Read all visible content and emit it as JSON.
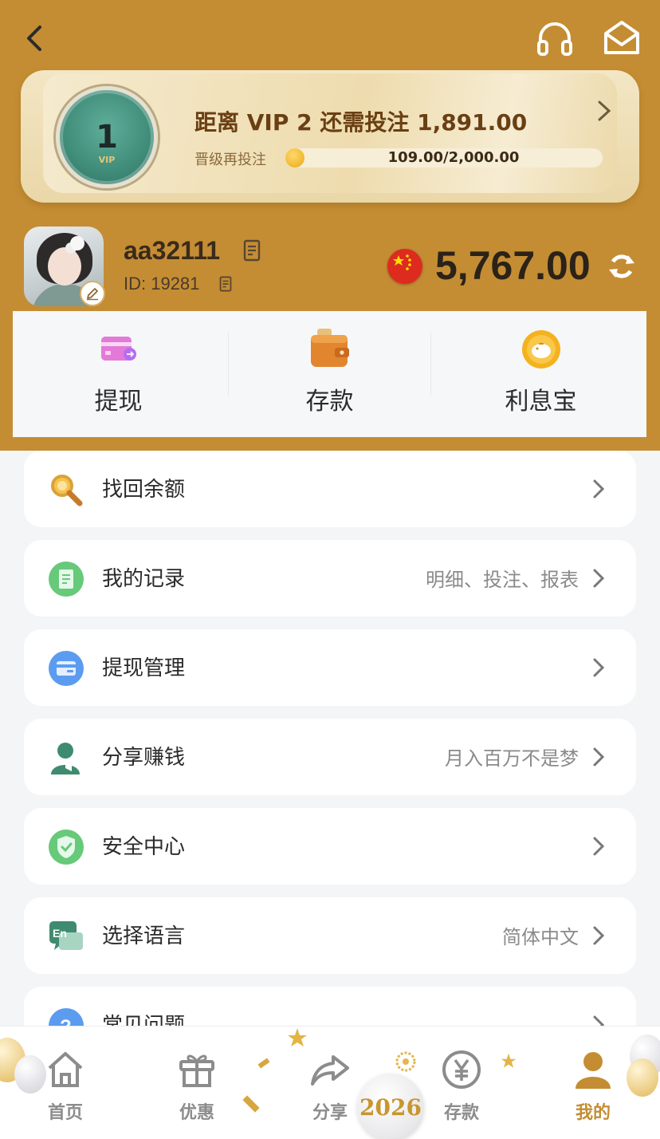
{
  "colors": {
    "brand_gold": "#c48d33",
    "background": "#f4f5f7",
    "active_tab": "#c48d33"
  },
  "header": {
    "icons": [
      "back-icon",
      "headset-icon",
      "mail-icon"
    ]
  },
  "vip": {
    "level_badge": "1",
    "badge_tag": "VIP",
    "headline": "距离 VIP 2 还需投注 1,891.00",
    "progress_label": "晋级再投注",
    "progress_text": "109.00/2,000.00",
    "progress_fraction": 0.0545
  },
  "profile": {
    "username": "aa32111",
    "user_id": "ID: 19281",
    "balance": "5,767.00",
    "currency_flag": "china-flag-icon"
  },
  "quick_actions": [
    {
      "label": "提现",
      "icon": "withdraw-card-icon"
    },
    {
      "label": "存款",
      "icon": "wallet-icon"
    },
    {
      "label": "利息宝",
      "icon": "piggy-bank-icon"
    }
  ],
  "menu": [
    {
      "label": "找回余额",
      "value": "",
      "icon": "search-icon"
    },
    {
      "label": "我的记录",
      "value": "明细、投注、报表",
      "icon": "record-icon"
    },
    {
      "label": "提现管理",
      "value": "",
      "icon": "card-icon"
    },
    {
      "label": "分享赚钱",
      "value": "月入百万不是梦",
      "icon": "share-user-icon"
    },
    {
      "label": "安全中心",
      "value": "",
      "icon": "shield-icon"
    },
    {
      "label": "选择语言",
      "value": "简体中文",
      "icon": "language-icon"
    },
    {
      "label": "常见问题",
      "value": "",
      "icon": "help-icon"
    }
  ],
  "tabbar": [
    {
      "label": "首页",
      "icon": "home-icon"
    },
    {
      "label": "优惠",
      "icon": "gift-icon"
    },
    {
      "label": "分享",
      "icon": "share-arrow-icon"
    },
    {
      "label": "存款",
      "icon": "yen-coin-icon"
    },
    {
      "label": "我的",
      "icon": "profile-icon",
      "active": true
    }
  ],
  "decoration": {
    "year_badge": "2026"
  }
}
